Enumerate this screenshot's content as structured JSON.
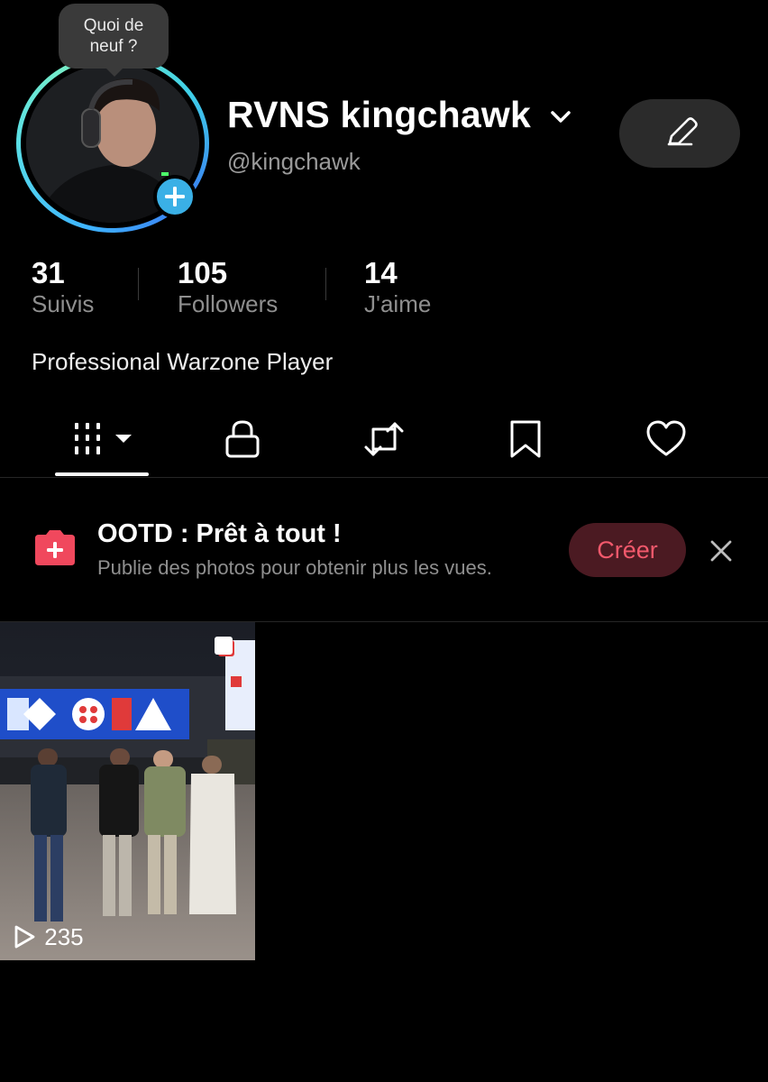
{
  "tooltip": {
    "text_line1": "Quoi de",
    "text_line2": "neuf ?"
  },
  "profile": {
    "display_name": "RVNS kingchawk",
    "handle": "@kingchawk",
    "bio": "Professional Warzone Player"
  },
  "stats": [
    {
      "value": "31",
      "label": "Suivis"
    },
    {
      "value": "105",
      "label": "Followers"
    },
    {
      "value": "14",
      "label": "J'aime"
    }
  ],
  "tabs": [
    {
      "icon": "grid-icon",
      "active": true
    },
    {
      "icon": "lock-icon",
      "active": false
    },
    {
      "icon": "repost-icon",
      "active": false
    },
    {
      "icon": "bookmark-icon",
      "active": false
    },
    {
      "icon": "heart-icon",
      "active": false
    }
  ],
  "promo": {
    "title": "OOTD : Prêt à tout !",
    "subtitle": "Publie des photos pour obtenir plus les vues.",
    "cta_label": "Créer"
  },
  "videos": [
    {
      "views": "235"
    }
  ],
  "colors": {
    "background": "#000000",
    "accent": "#f2596c",
    "avatar_ring": "#3fb6ff"
  }
}
